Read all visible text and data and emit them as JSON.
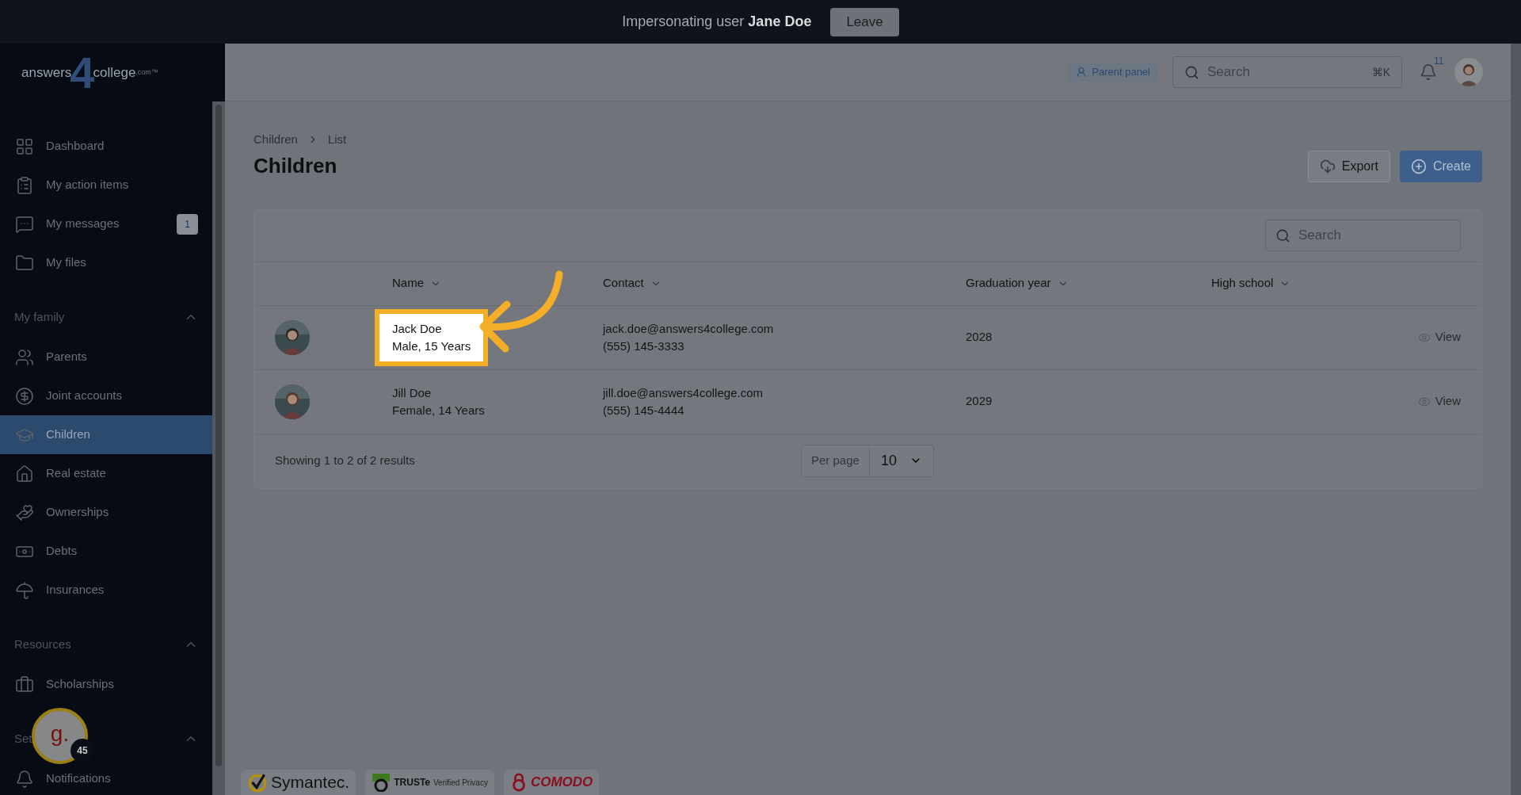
{
  "impersonation_bar": {
    "text": "Impersonating user **Jane Doe**",
    "leave_button": "Leave"
  },
  "logo": {
    "parts": [
      "answers",
      "4",
      "college",
      ".com™"
    ]
  },
  "sidebar": {
    "sections": [
      {
        "items": [
          {
            "label": "Dashboard",
            "selected": false
          },
          {
            "label": "My action items",
            "selected": false
          },
          {
            "label": "My messages",
            "badge": "1",
            "selected": false
          },
          {
            "label": "My files",
            "selected": false
          }
        ]
      },
      {
        "title": "My family",
        "expanded": true,
        "items": [
          {
            "label": "Parents",
            "selected": false
          },
          {
            "label": "Joint accounts",
            "selected": false
          },
          {
            "label": "Children",
            "selected": true
          },
          {
            "label": "Real estate",
            "selected": false
          },
          {
            "label": "Ownerships",
            "selected": false
          },
          {
            "label": "Debts",
            "selected": false
          },
          {
            "label": "Insurances",
            "selected": false
          }
        ]
      },
      {
        "title": "Resources",
        "expanded": true,
        "items": [
          {
            "label": "Scholarships",
            "selected": false
          }
        ]
      },
      {
        "title": "Set",
        "expanded": true,
        "items": [
          {
            "label": "Notifications",
            "selected": false
          }
        ]
      }
    ]
  },
  "header": {
    "parent_panel": "Parent panel",
    "search": {
      "placeholder": "Search",
      "shortcut": "⌘K"
    },
    "notification_count": "11"
  },
  "page": {
    "breadcrumb": [
      "Children",
      "List"
    ],
    "title": "Children",
    "buttons": [
      {
        "kind": "export",
        "label": "Export"
      },
      {
        "kind": "create",
        "label": "Create"
      }
    ]
  },
  "table": {
    "search_placeholder": "Search",
    "columns": [
      {
        "label": "Name"
      },
      {
        "label": "Contact"
      },
      {
        "label": "Graduation year"
      },
      {
        "label": "High school"
      }
    ],
    "rows": [
      {
        "name": "Jack Doe",
        "detail": "Male, 15 Years",
        "email": "jack.doe@answers4college.com",
        "phone": "(555) 145-3333",
        "graduation_year": "2028",
        "action": "View",
        "highlighted": true
      },
      {
        "name": "Jill Doe",
        "detail": "Female, 14 Years",
        "email": "jill.doe@answers4college.com",
        "phone": "(555) 145-4444",
        "graduation_year": "2029",
        "action": "View",
        "highlighted": false
      }
    ],
    "summary": "Showing 1 to 2 of 2 results",
    "per_page": {
      "label": "Per page",
      "value": "10"
    }
  },
  "widget": {
    "letter": "g.",
    "count": "45"
  },
  "trust_badges": [
    {
      "kind": "symantec",
      "name": "Symantec."
    },
    {
      "kind": "truste",
      "name": "TRUSTe",
      "caption": "Verified Privacy"
    },
    {
      "kind": "comodo",
      "name": "COMODO"
    }
  ]
}
